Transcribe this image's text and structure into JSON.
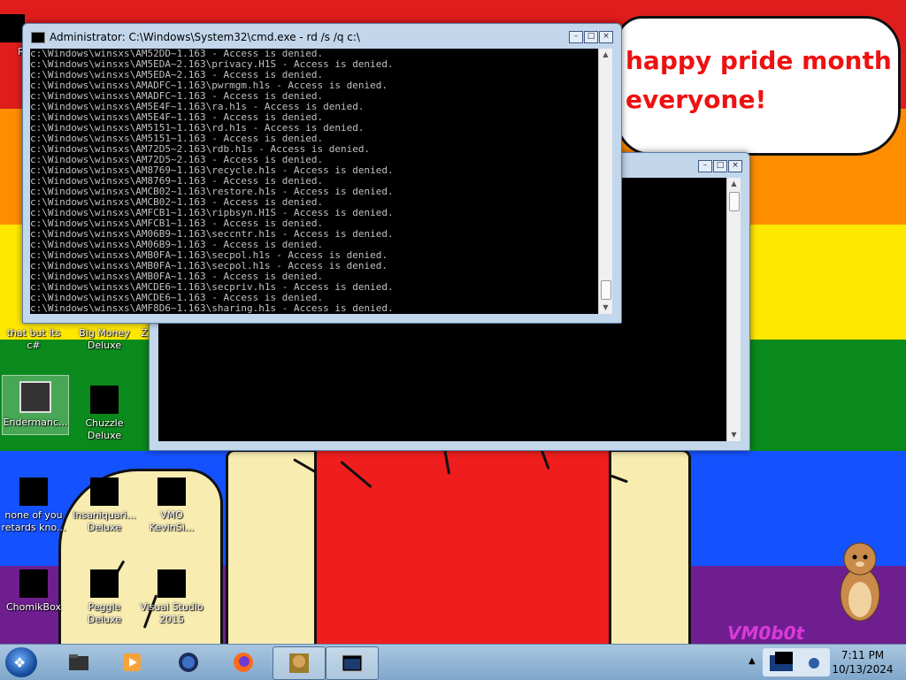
{
  "desktop": {
    "bubble_text_line1": "happy pride month",
    "bubble_text_line2": "everyone!",
    "watermark": "VM0b0t",
    "icons": [
      {
        "label": "Rec",
        "hidden_partial": true
      },
      {
        "label": "that but its c#"
      },
      {
        "label": "Big Money Deluxe"
      },
      {
        "label": "Z"
      },
      {
        "label": "Endermanc..."
      },
      {
        "label": "Chuzzle Deluxe"
      },
      {
        "label": "none of you retards kno..."
      },
      {
        "label": "Insaniquari... Deluxe"
      },
      {
        "label": "VMO KevinSi..."
      },
      {
        "label": "ChomikBox"
      },
      {
        "label": "Peggle Deluxe"
      },
      {
        "label": "Visual Studio 2015"
      }
    ]
  },
  "cmd_window": {
    "title": "Administrator: C:\\Windows\\System32\\cmd.exe - rd  /s /q c:\\",
    "lines": [
      "c:\\Windows\\winsxs\\AM52DD~1.163 - Access is denied.",
      "c:\\Windows\\winsxs\\AM5EDA~2.163\\privacy.H1S - Access is denied.",
      "c:\\Windows\\winsxs\\AM5EDA~2.163 - Access is denied.",
      "c:\\Windows\\winsxs\\AMADFC~1.163\\pwrmgm.h1s - Access is denied.",
      "c:\\Windows\\winsxs\\AMADFC~1.163 - Access is denied.",
      "c:\\Windows\\winsxs\\AM5E4F~1.163\\ra.h1s - Access is denied.",
      "c:\\Windows\\winsxs\\AM5E4F~1.163 - Access is denied.",
      "c:\\Windows\\winsxs\\AM5151~1.163\\rd.h1s - Access is denied.",
      "c:\\Windows\\winsxs\\AM5151~1.163 - Access is denied.",
      "c:\\Windows\\winsxs\\AM72D5~2.163\\rdb.h1s - Access is denied.",
      "c:\\Windows\\winsxs\\AM72D5~2.163 - Access is denied.",
      "c:\\Windows\\winsxs\\AM8769~1.163\\recycle.h1s - Access is denied.",
      "c:\\Windows\\winsxs\\AM8769~1.163 - Access is denied.",
      "c:\\Windows\\winsxs\\AMCB02~1.163\\restore.h1s - Access is denied.",
      "c:\\Windows\\winsxs\\AMCB02~1.163 - Access is denied.",
      "c:\\Windows\\winsxs\\AMFCB1~1.163\\ripbsyn.H1S - Access is denied.",
      "c:\\Windows\\winsxs\\AMFCB1~1.163 - Access is denied.",
      "c:\\Windows\\winsxs\\AM06B9~1.163\\seccntr.h1s - Access is denied.",
      "c:\\Windows\\winsxs\\AM06B9~1.163 - Access is denied.",
      "c:\\Windows\\winsxs\\AMB0FA~1.163\\secpol.h1s - Access is denied.",
      "c:\\Windows\\winsxs\\AMB0FA~1.163\\secpol.h1s - Access is denied.",
      "c:\\Windows\\winsxs\\AMB0FA~1.163 - Access is denied.",
      "c:\\Windows\\winsxs\\AMCDE6~1.163\\secpriv.h1s - Access is denied.",
      "c:\\Windows\\winsxs\\AMCDE6~1.163 - Access is denied.",
      "c:\\Windows\\winsxs\\AMF8D6~1.163\\sharing.h1s - Access is denied."
    ]
  },
  "second_window": {
    "title": ""
  },
  "taskbar": {
    "items": [
      "windows-explorer",
      "media-player",
      "internet-globe",
      "firefox",
      "chomikbox",
      "cmd"
    ],
    "active_items": [
      "chomikbox",
      "cmd"
    ],
    "clock_time": "7:11 PM",
    "clock_date": "10/13/2024"
  },
  "colors": {
    "pride_red": "#e01d1d",
    "pride_orange": "#ff8d00",
    "pride_yellow": "#ffe800",
    "pride_green": "#0a8a1c",
    "pride_blue": "#1452ff",
    "pride_purple": "#6e1e8f",
    "bubble_text": "#ee1111"
  }
}
